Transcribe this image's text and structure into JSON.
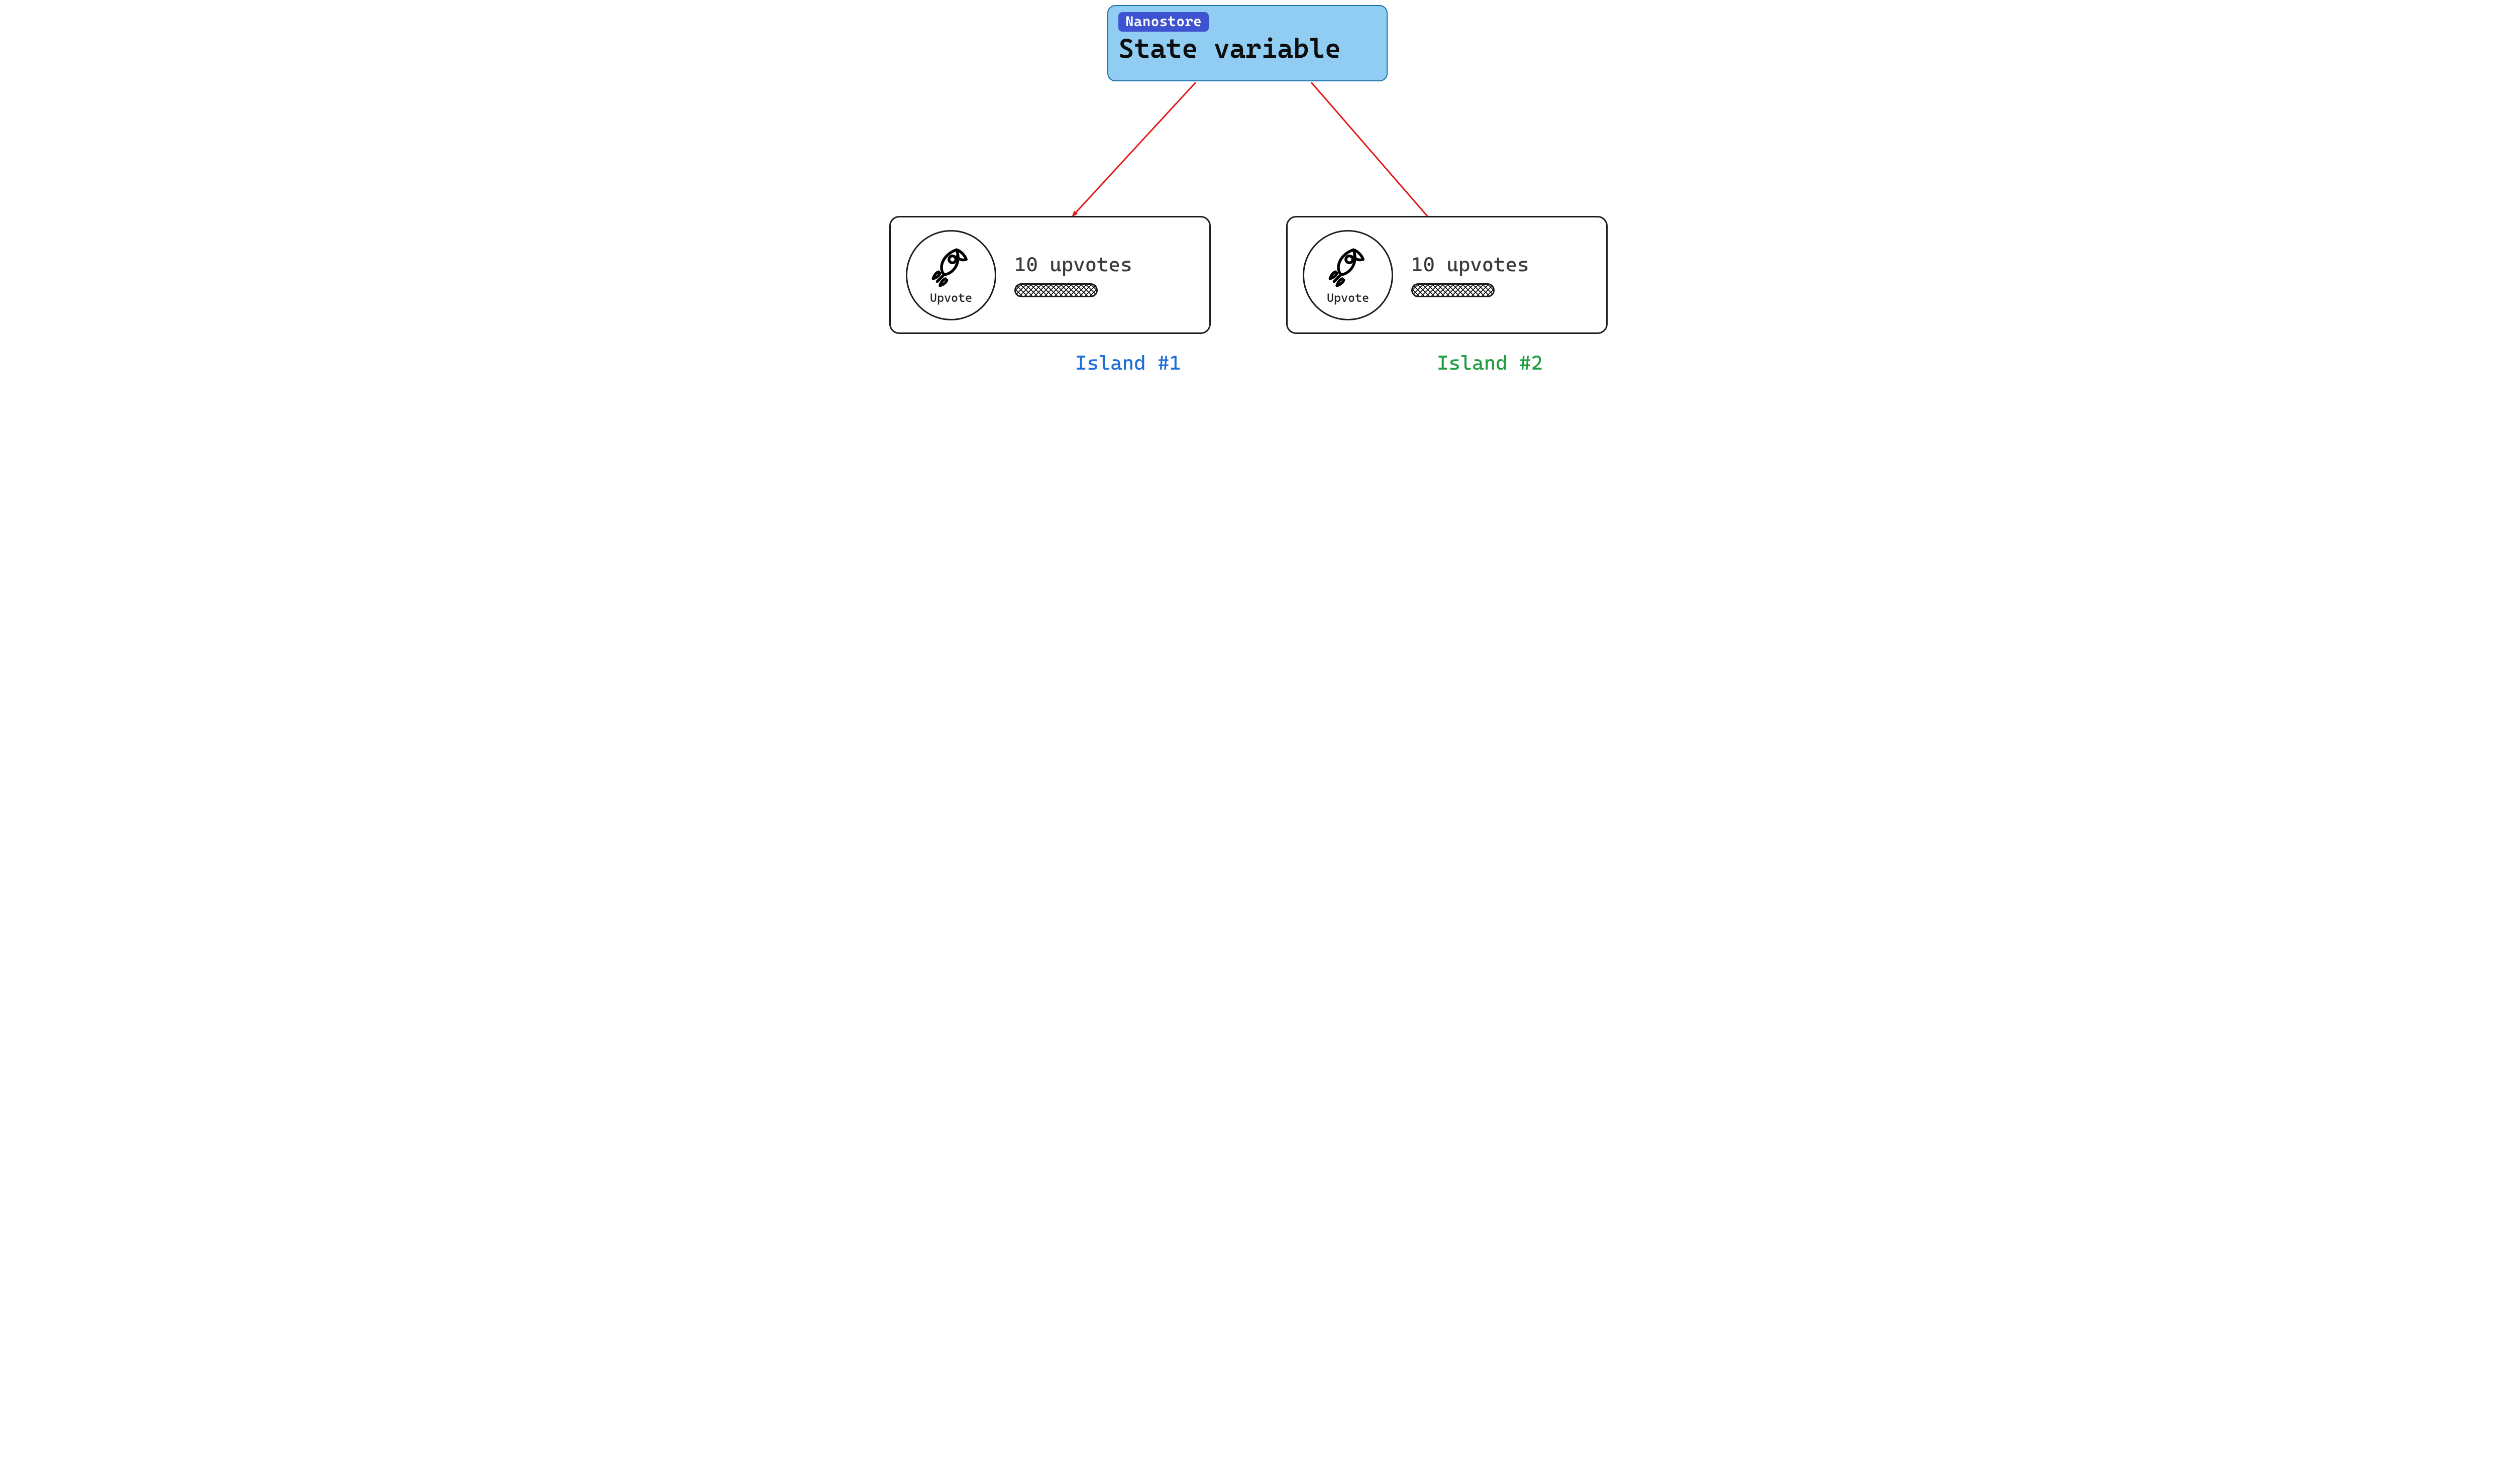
{
  "statebox": {
    "badge": "Nanostore",
    "title": "State variable"
  },
  "islands": [
    {
      "upvote_label": "Upvote",
      "count_text": "10 upvotes",
      "caption": "Island #1"
    },
    {
      "upvote_label": "Upvote",
      "count_text": "10 upvotes",
      "caption": "Island #2"
    }
  ],
  "colors": {
    "statebox_bg": "#91cdf2",
    "statebox_border": "#1b71a8",
    "badge_bg": "#3e53d1",
    "arrow": "#e01919",
    "caption1": "#1e6fd9",
    "caption2": "#1e9e3e",
    "card_border": "#1c1c1c"
  }
}
